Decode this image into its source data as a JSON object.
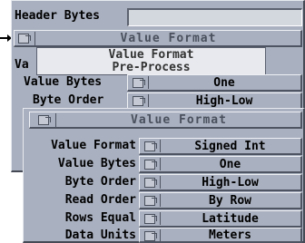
{
  "back_panel": {
    "header_bytes_label": "Header Bytes",
    "header_bytes_value": "",
    "title": "Value Format",
    "truncated_label": "Va",
    "popup_options": [
      "Value Format",
      "Pre-Process"
    ],
    "value_bytes_label": "Value Bytes",
    "value_bytes_value": "One",
    "byte_order_label": "Byte Order",
    "byte_order_value": "High-Low"
  },
  "front_panel": {
    "title": "Value Format",
    "rows": [
      {
        "label": "Value Format",
        "value": "Signed Int"
      },
      {
        "label": "Value Bytes",
        "value": "One"
      },
      {
        "label": "Byte Order",
        "value": "High-Low"
      },
      {
        "label": "Read Order",
        "value": "By Row"
      },
      {
        "label": "Rows Equal",
        "value": "Latitude"
      },
      {
        "label": "Data Units",
        "value": "Meters"
      }
    ]
  },
  "icons": {
    "cycle": "cycle-gadget-icon",
    "pointer": "arrow-pointer-icon"
  }
}
